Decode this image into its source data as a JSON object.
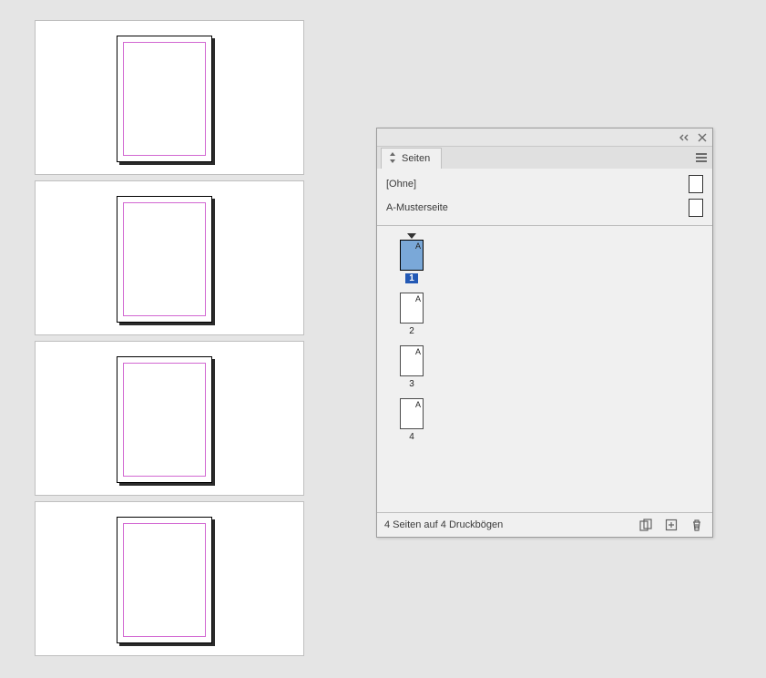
{
  "spreads": {
    "count": 4
  },
  "panel": {
    "tab_label": "Seiten",
    "masters": [
      {
        "label": "[Ohne]"
      },
      {
        "label": "A-Musterseite"
      }
    ],
    "pages": [
      {
        "prefix": "A",
        "number": "1",
        "active": true
      },
      {
        "prefix": "A",
        "number": "2",
        "active": false
      },
      {
        "prefix": "A",
        "number": "3",
        "active": false
      },
      {
        "prefix": "A",
        "number": "4",
        "active": false
      }
    ],
    "footer_status": "4 Seiten auf 4 Druckbögen"
  }
}
